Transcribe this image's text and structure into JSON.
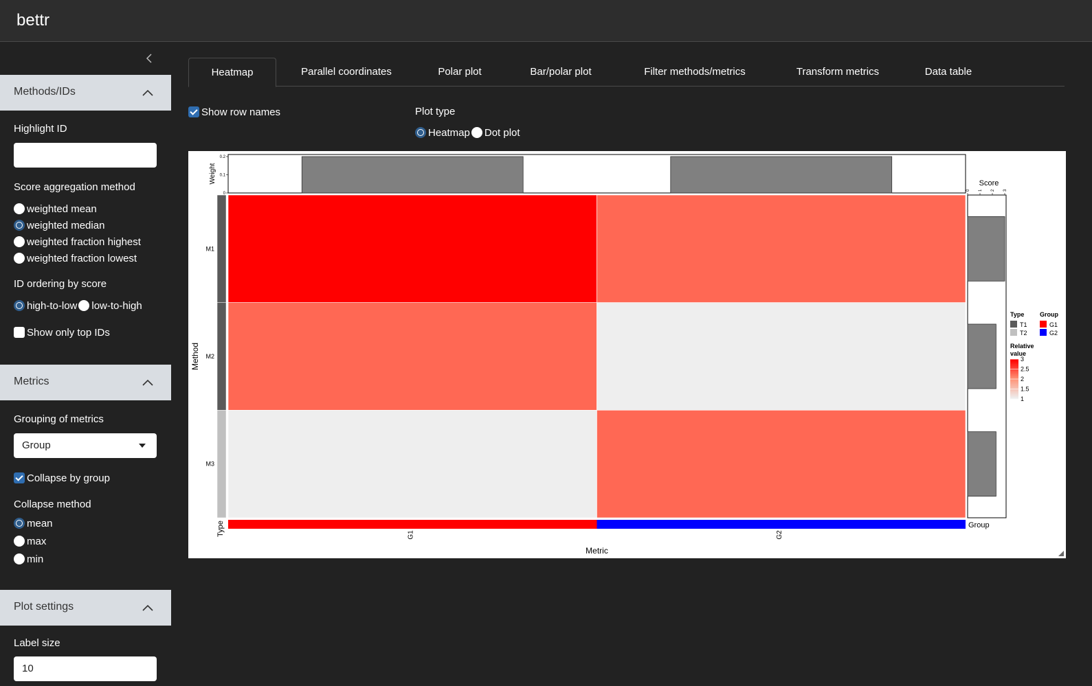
{
  "app": {
    "title": "bettr"
  },
  "sidebar": {
    "collapse_icon": "chevron-left-icon",
    "methods_section": {
      "title": "Methods/IDs",
      "highlight_label": "Highlight ID",
      "highlight_value": "",
      "score_agg_label": "Score aggregation method",
      "score_agg_options": [
        "weighted mean",
        "weighted median",
        "weighted fraction highest",
        "weighted fraction lowest"
      ],
      "score_agg_selected": "weighted median",
      "ordering_label": "ID ordering by score",
      "ordering_options": [
        "high-to-low",
        "low-to-high"
      ],
      "ordering_selected": "high-to-low",
      "top_ids_label": "Show only top IDs",
      "top_ids_checked": false
    },
    "metrics_section": {
      "title": "Metrics",
      "grouping_label": "Grouping of metrics",
      "grouping_value": "Group",
      "collapse_group_label": "Collapse by group",
      "collapse_group_checked": true,
      "collapse_method_label": "Collapse method",
      "collapse_method_options": [
        "mean",
        "max",
        "min"
      ],
      "collapse_method_selected": "mean"
    },
    "plot_section": {
      "title": "Plot settings",
      "label_size_label": "Label size",
      "label_size_value": "10"
    }
  },
  "main": {
    "tabs": [
      "Heatmap",
      "Parallel coordinates",
      "Polar plot",
      "Bar/polar plot",
      "Filter methods/metrics",
      "Transform metrics",
      "Data table"
    ],
    "active_tab": "Heatmap",
    "show_row_names_label": "Show row names",
    "show_row_names_checked": true,
    "plot_type_label": "Plot type",
    "plot_type_options": [
      "Heatmap",
      "Dot plot"
    ],
    "plot_type_selected": "Heatmap"
  },
  "colors": {
    "navbar": "#2d2d2d",
    "background": "#222222",
    "section_header": "#d9dde2",
    "accent": "#2f5d8c",
    "high": "#ff0000",
    "mid": "#ff9478",
    "low": "#eeeeee",
    "bar": "#808080",
    "type_T1": "#5a5a5a",
    "type_T2": "#c0c0c0",
    "group_G1": "#ff0000",
    "group_G2": "#0000ff"
  },
  "chart_data": {
    "type": "heatmap",
    "xlabel": "Metric",
    "ylabel": "Method",
    "columns": [
      "G1",
      "G2"
    ],
    "rows": [
      "M1",
      "M2",
      "M3"
    ],
    "values": [
      [
        3,
        2.3
      ],
      [
        2.3,
        1
      ],
      [
        1,
        2.3
      ]
    ],
    "row_type": [
      "T1",
      "T1",
      "T2"
    ],
    "column_group": [
      "G1",
      "G2"
    ],
    "column_annotation_label": "Group",
    "row_annotation_label": "Type",
    "weight_bar": {
      "label": "Weight",
      "ticks": [
        "0.2",
        "0.1",
        "0"
      ],
      "ylim": [
        0,
        0.2
      ],
      "values": [
        0.2,
        0.2
      ]
    },
    "score_bar": {
      "label": "Score",
      "ticks": [
        "0",
        "1",
        "2",
        "3"
      ],
      "xlim": [
        0,
        3
      ],
      "values": [
        3,
        2.3,
        2.3
      ]
    },
    "legends": {
      "type": {
        "title": "Type",
        "entries": [
          "T1",
          "T2"
        ]
      },
      "group": {
        "title": "Group",
        "entries": [
          "G1",
          "G2"
        ]
      },
      "relative_value": {
        "title_line1": "Relative",
        "title_line2": "value",
        "ticks": [
          "3",
          "2.5",
          "2",
          "1.5",
          "1"
        ],
        "range": [
          1,
          3
        ]
      }
    }
  }
}
